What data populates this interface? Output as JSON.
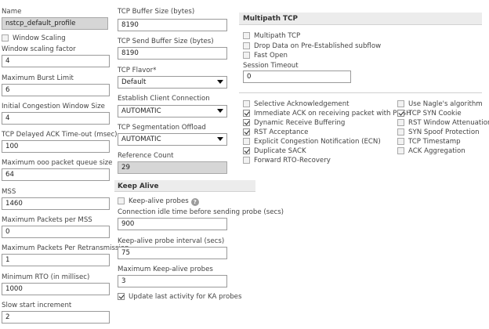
{
  "col1": {
    "name_label": "Name",
    "name_value": "nstcp_default_profile",
    "window_scaling_label": "Window Scaling",
    "window_scaling_checked": false,
    "window_scaling_factor_label": "Window scaling factor",
    "window_scaling_factor_value": "4",
    "max_burst_label": "Maximum Burst Limit",
    "max_burst_value": "6",
    "initial_cwnd_label": "Initial Congestion Window Size",
    "initial_cwnd_value": "4",
    "delayed_ack_label": "TCP Delayed ACK Time-out (msec)",
    "delayed_ack_value": "100",
    "max_ooo_label": "Maximum ooo packet queue size",
    "max_ooo_value": "64",
    "mss_label": "MSS",
    "mss_value": "1460",
    "max_pkts_mss_label": "Maximum Packets per MSS",
    "max_pkts_mss_value": "0",
    "max_pkts_retrans_label": "Maximum Packets Per Retransmission",
    "max_pkts_retrans_value": "1",
    "min_rto_label": "Minimum RTO (in millisec)",
    "min_rto_value": "1000",
    "slow_start_label": "Slow start increment",
    "slow_start_value": "2"
  },
  "col2": {
    "buffer_size_label": "TCP Buffer Size (bytes)",
    "buffer_size_value": "8190",
    "send_buffer_label": "TCP Send Buffer Size (bytes)",
    "send_buffer_value": "8190",
    "flavor_label": "TCP Flavor*",
    "flavor_value": "Default",
    "establish_label": "Establish Client Connection",
    "establish_value": "AUTOMATIC",
    "segmentation_label": "TCP Segmentation Offload",
    "segmentation_value": "AUTOMATIC",
    "refcount_label": "Reference Count",
    "refcount_value": "29"
  },
  "keepalive": {
    "heading": "Keep Alive",
    "probes_label": "Keep-alive probes",
    "probes_checked": false,
    "idle_label": "Connection idle time before sending probe (secs)",
    "idle_value": "900",
    "interval_label": "Keep-alive probe interval (secs)",
    "interval_value": "75",
    "max_probes_label": "Maximum Keep-alive probes",
    "max_probes_value": "3",
    "update_label": "Update last activity for KA probes",
    "update_checked": true
  },
  "multipath": {
    "heading": "Multipath TCP",
    "mptcp_label": "Multipath TCP",
    "drop_label": "Drop Data on Pre-Established subflow",
    "fastopen_label": "Fast Open",
    "session_timeout_label": "Session Timeout",
    "session_timeout_value": "0"
  },
  "options_left": [
    {
      "label": "Selective Acknowledgement",
      "checked": false
    },
    {
      "label": "Immediate ACK on receiving packet with PUSH",
      "checked": true
    },
    {
      "label": "Dynamic Receive Buffering",
      "checked": true
    },
    {
      "label": "RST Acceptance",
      "checked": true
    },
    {
      "label": "Explicit Congestion Notification (ECN)",
      "checked": false
    },
    {
      "label": "Duplicate SACK",
      "checked": true
    },
    {
      "label": "Forward RTO-Recovery",
      "checked": false
    }
  ],
  "options_right": [
    {
      "label": "Use Nagle's algorithm",
      "checked": false
    },
    {
      "label": "TCP SYN Cookie",
      "checked": true
    },
    {
      "label": "RST Window Attenuation",
      "checked": false
    },
    {
      "label": "SYN Spoof Protection",
      "checked": false
    },
    {
      "label": "TCP Timestamp",
      "checked": false
    },
    {
      "label": "ACK Aggregation",
      "checked": false
    }
  ],
  "colors": {
    "readonly_bg": "#d6d6d6",
    "section_bg": "#ececec",
    "border": "#9a9a9a"
  }
}
